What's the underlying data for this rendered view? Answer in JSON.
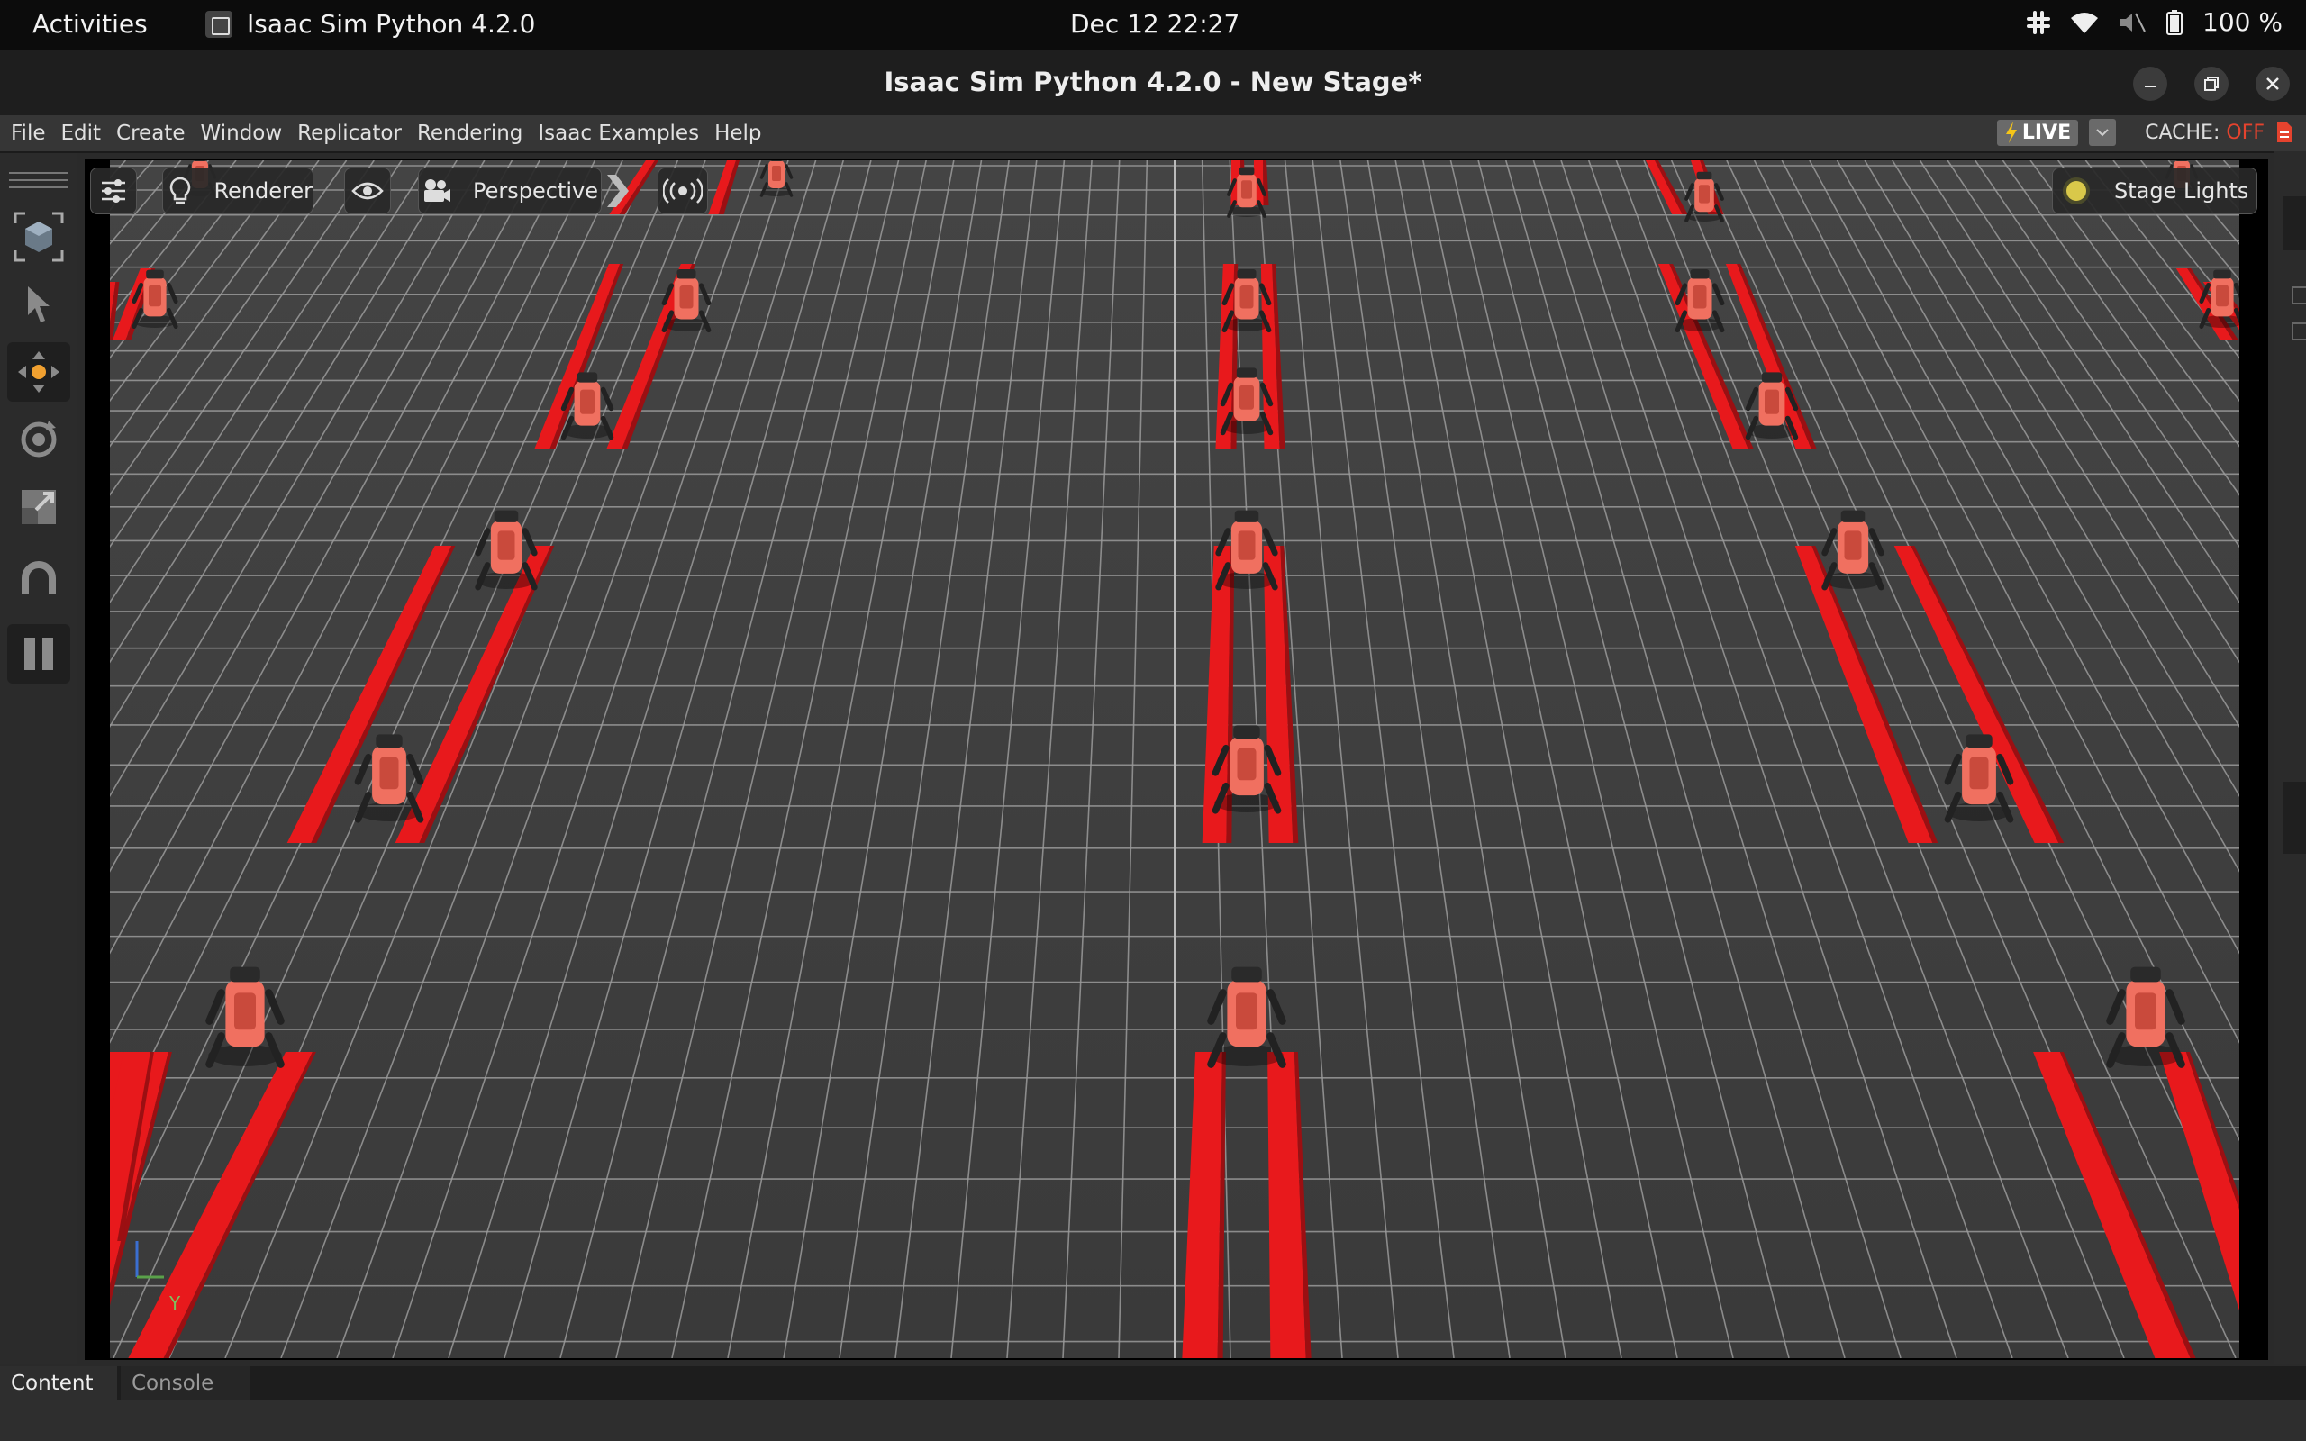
{
  "topbar": {
    "activities": "Activities",
    "app_name": "Isaac Sim Python 4.2.0",
    "clock": "Dec 12  22:27",
    "battery": "100 %",
    "icons": [
      "slack-icon",
      "wifi-icon",
      "volume-muted-icon",
      "battery-icon"
    ]
  },
  "window": {
    "title": "Isaac Sim Python 4.2.0 - New Stage*",
    "controls": [
      "minimize",
      "maximize",
      "close"
    ]
  },
  "menu": {
    "items": [
      "File",
      "Edit",
      "Create",
      "Window",
      "Replicator",
      "Rendering",
      "Isaac Examples",
      "Help"
    ],
    "live": "LIVE",
    "cache_label": "CACHE:",
    "cache_state": "OFF"
  },
  "viewport": {
    "renderer": "Renderer",
    "camera": "Perspective",
    "lights": "Stage Lights",
    "axis_label": "Y"
  },
  "tools": [
    "select-icon",
    "move-icon",
    "rotate-icon",
    "scale-icon",
    "snap-icon",
    "pause-icon"
  ],
  "bottom": {
    "tabs": [
      "Content",
      "Console"
    ]
  },
  "colors": {
    "accent_red": "#e5432e",
    "live_yellow": "#f5c518",
    "rail_red": "#e8191c",
    "robot_orange": "#f07060"
  }
}
